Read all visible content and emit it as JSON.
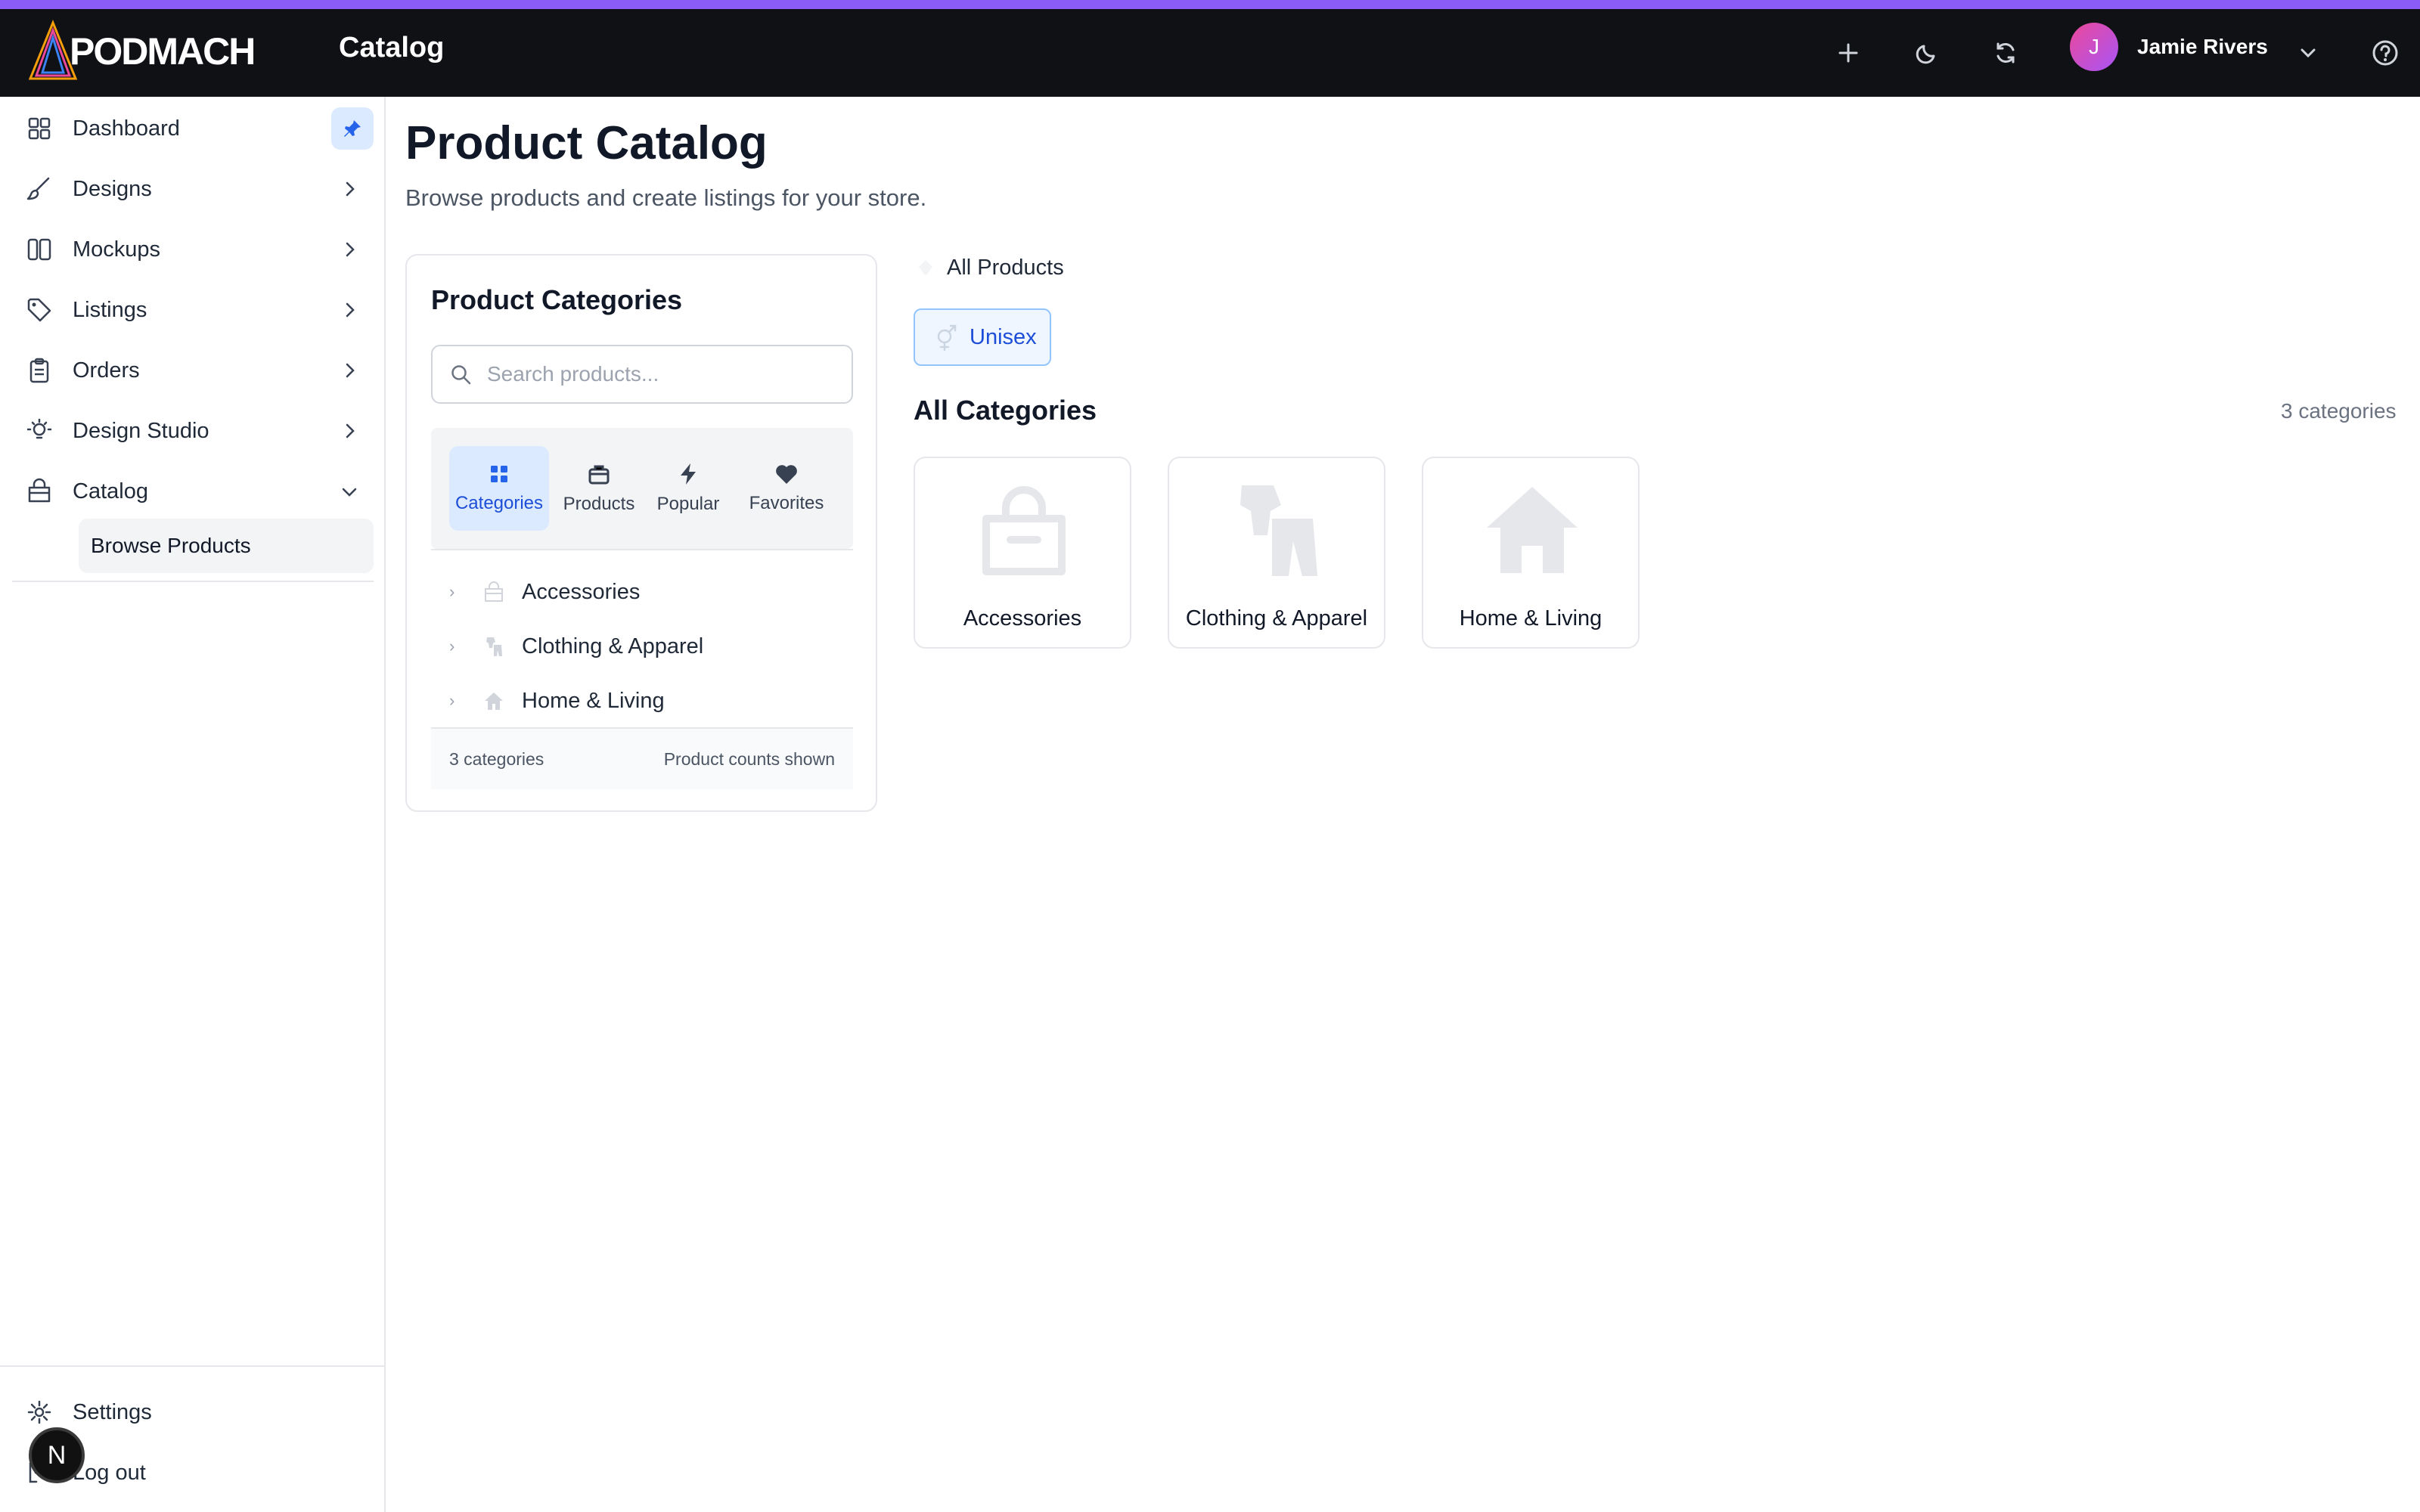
{
  "colors": {
    "accent": "#8b5cf6",
    "topbar": "#0f1115",
    "active": "#1d4ed8",
    "active_bg": "#dbeafe"
  },
  "header": {
    "logo": "PODMACH",
    "title": "Catalog",
    "user": {
      "initial": "J",
      "name": "Jamie Rivers"
    },
    "icons": [
      "plus-icon",
      "moon-icon",
      "refresh-icon",
      "chevron-down-icon",
      "help-icon"
    ]
  },
  "sidebar": {
    "items": [
      {
        "label": "Dashboard",
        "icon": "grid-icon"
      },
      {
        "label": "Designs",
        "icon": "brush-icon"
      },
      {
        "label": "Mockups",
        "icon": "columns-icon"
      },
      {
        "label": "Listings",
        "icon": "tag-icon"
      },
      {
        "label": "Orders",
        "icon": "clipboard-icon"
      },
      {
        "label": "Design Studio",
        "icon": "bulb-icon"
      },
      {
        "label": "Catalog",
        "icon": "bag-icon"
      }
    ],
    "sub_item": "Browse Products",
    "bottom": [
      {
        "label": "Settings",
        "icon": "gear-icon"
      },
      {
        "label": "Log out",
        "icon": "logout-icon"
      }
    ],
    "badge": "N"
  },
  "main": {
    "title": "Product Catalog",
    "subtitle": "Browse products and create listings for your store."
  },
  "panel": {
    "title": "Product Categories",
    "search_placeholder": "Search products...",
    "tabs": [
      {
        "label": "Categories",
        "icon": "grid-icon",
        "active": true
      },
      {
        "label": "Products",
        "icon": "box-icon"
      },
      {
        "label": "Popular",
        "icon": "bolt-icon"
      },
      {
        "label": "Favorites",
        "icon": "heart-icon"
      }
    ],
    "tree": [
      "Accessories",
      "Clothing & Apparel",
      "Home & Living"
    ],
    "footer_left": "3 categories",
    "footer_right": "Product counts shown"
  },
  "content": {
    "breadcrumb": "All Products",
    "chip": "Unisex",
    "section_title": "All Categories",
    "section_count": "3 categories",
    "cards": [
      "Accessories",
      "Clothing & Apparel",
      "Home & Living"
    ]
  }
}
